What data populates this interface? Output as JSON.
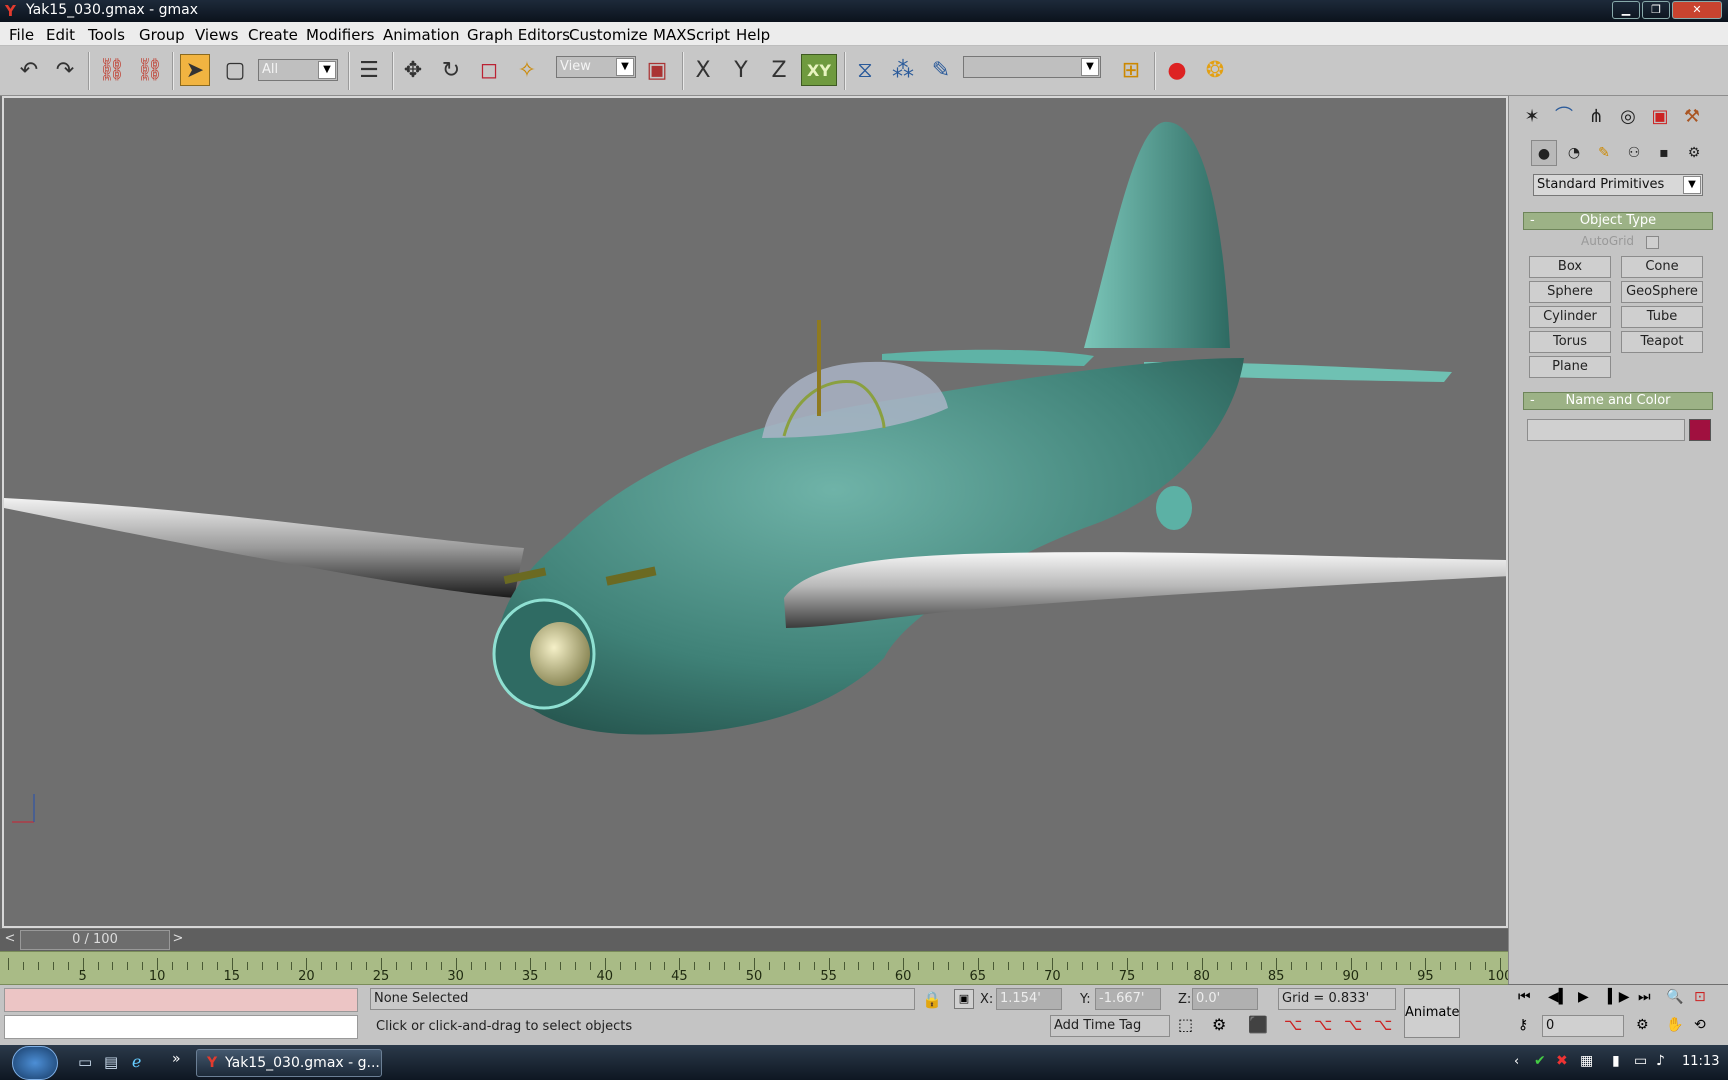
{
  "window": {
    "title": "Yak15_030.gmax - gmax",
    "minimize": "▁",
    "maximize": "❐",
    "close": "✕"
  },
  "menu": [
    "File",
    "Edit",
    "Tools",
    "Group",
    "Views",
    "Create",
    "Modifiers",
    "Animation",
    "Graph Editors",
    "Customize",
    "MAXScript",
    "Help"
  ],
  "toolbar": {
    "selection_filter": "All",
    "reference_coord": "View",
    "axis": {
      "x": "X",
      "y": "Y",
      "z": "Z",
      "xy": "XY"
    },
    "named_selection": ""
  },
  "command_panel": {
    "category_dropdown": "Standard Primitives",
    "object_type": {
      "header": "Object Type",
      "collapse": "-",
      "autogrid": "AutoGrid",
      "buttons": [
        "Box",
        "Cone",
        "Sphere",
        "GeoSphere",
        "Cylinder",
        "Tube",
        "Torus",
        "Teapot",
        "Plane"
      ]
    },
    "name_and_color": {
      "header": "Name and Color",
      "collapse": "-",
      "name_value": "",
      "color": "#a0103f"
    }
  },
  "timeline": {
    "frame_display": "0 / 100",
    "prev": "<",
    "next": ">",
    "ticks": [
      "5",
      "10",
      "15",
      "20",
      "25",
      "30",
      "35",
      "40",
      "45",
      "50",
      "55",
      "60",
      "65",
      "70",
      "75",
      "80",
      "85",
      "90",
      "95",
      "100"
    ]
  },
  "status": {
    "selection_info": "None Selected",
    "prompt": "Click or click-and-drag to select objects",
    "x_label": "X:",
    "x_value": "1.154'",
    "y_label": "Y:",
    "y_value": "-1.667'",
    "z_label": "Z:",
    "z_value": "0.0'",
    "grid": "Grid = 0.833'",
    "add_time_tag": "Add Time Tag",
    "animate": "Animate",
    "frame_field": "0"
  },
  "taskbar": {
    "task": "Yak15_030.gmax - g...",
    "more": "»",
    "clock": "11:13"
  },
  "colors": {
    "viewport_bg": "#6f6f6f",
    "model": "#4f9b91",
    "active_tool": "#f1b441",
    "rollout_header": "#9cb286"
  }
}
